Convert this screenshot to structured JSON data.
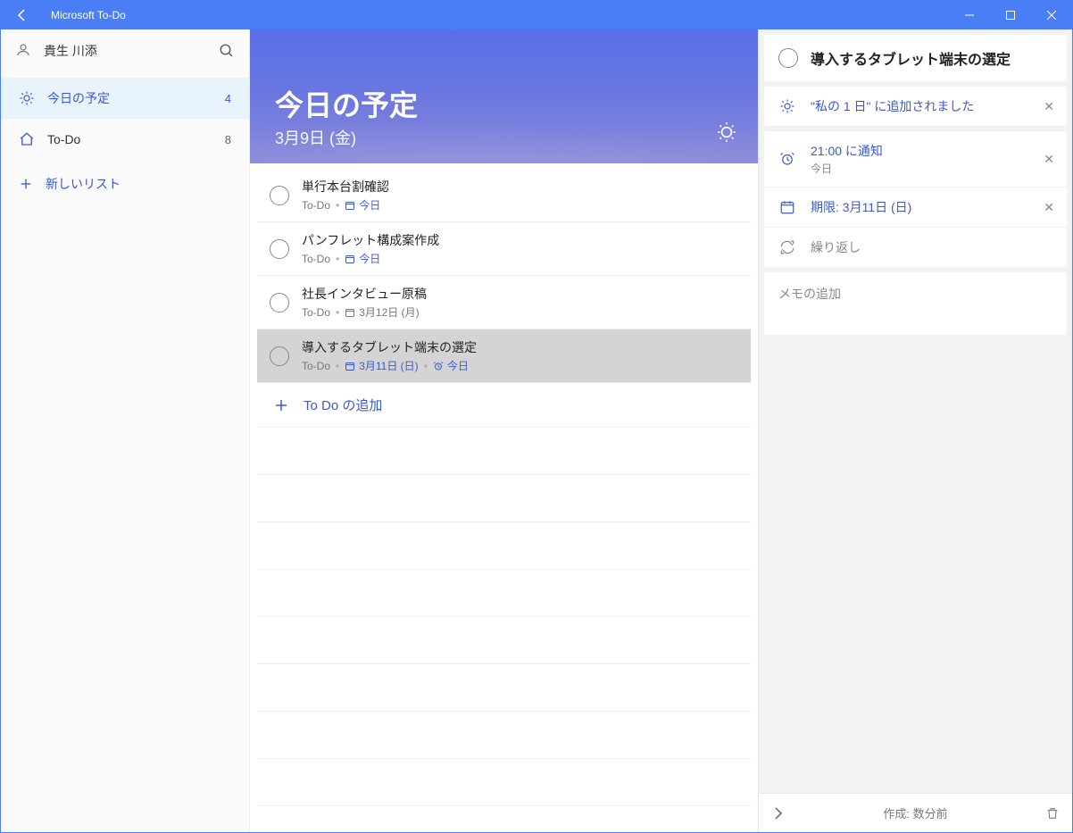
{
  "titlebar": {
    "app_name": "Microsoft To-Do"
  },
  "profile": {
    "name": "貴生 川添"
  },
  "sidebar": {
    "items": [
      {
        "label": "今日の予定",
        "count": "4",
        "active": true
      },
      {
        "label": "To-Do",
        "count": "8",
        "active": false
      }
    ],
    "new_list": "新しいリスト"
  },
  "hero": {
    "title": "今日の予定",
    "date": "3月9日 (金)"
  },
  "tasks": [
    {
      "name": "単行本台割確認",
      "list": "To-Do",
      "due": "今日",
      "due_type": "today",
      "alarm": "",
      "selected": false
    },
    {
      "name": "パンフレット構成案作成",
      "list": "To-Do",
      "due": "今日",
      "due_type": "today",
      "alarm": "",
      "selected": false
    },
    {
      "name": "社長インタビュー原稿",
      "list": "To-Do",
      "due": "3月12日 (月)",
      "due_type": "plain",
      "alarm": "",
      "selected": false
    },
    {
      "name": "導入するタブレット端末の選定",
      "list": "To-Do",
      "due": "3月11日 (日)",
      "due_type": "blue",
      "alarm": "今日",
      "selected": true
    }
  ],
  "add_task": "To Do の追加",
  "detail": {
    "title": "導入するタブレット端末の選定",
    "myday_text": "\"私の 1 日\" に追加されました",
    "reminder_text": "21:00 に通知",
    "reminder_sub": "今日",
    "due_text": "期限: 3月11日 (日)",
    "repeat_text": "繰り返し",
    "note_placeholder": "メモの追加",
    "created": "作成: 数分前"
  }
}
